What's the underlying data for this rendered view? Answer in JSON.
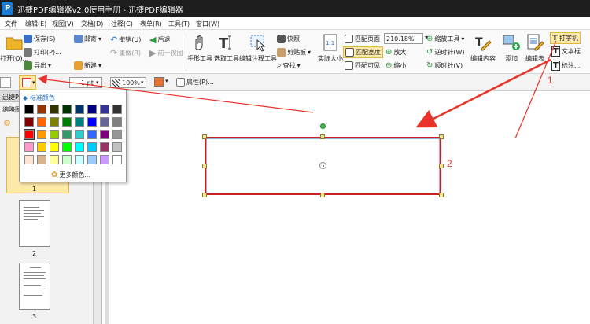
{
  "window": {
    "title": "迅捷PDF编辑器v2.0使用手册 - 迅捷PDF编辑器"
  },
  "menu": [
    "文件",
    "编辑(E)",
    "视图(V)",
    "文档(D)",
    "注释(C)",
    "表单(R)",
    "工具(T)",
    "窗口(W)"
  ],
  "ribbon": {
    "open": "打开(O)...",
    "save": "保存(S)",
    "print": "打印(P)...",
    "export": "导出",
    "email": "邮寄",
    "new": "新建",
    "undo": "撤销(U)",
    "redo": "重做(R)",
    "back": "后退",
    "forward": "前一视图",
    "hand": "手形工具",
    "select": "选取工具",
    "edit_annot": "编辑注释工具",
    "snapshot": "快照",
    "clipboard": "剪贴板",
    "find": "查找",
    "actual_size": "实际大小",
    "fit_page": "匹配页面",
    "fit_width": "匹配宽度",
    "fit_visible": "匹配可见",
    "zoom_value": "210.18%",
    "zoom_tool": "缩放工具",
    "zoom_in": "放大",
    "zoom_out": "缩小",
    "rotate_ccw": "逆时针(W)",
    "rotate_cw": "顺时针(V)",
    "edit_content": "编辑内容",
    "add": "添加",
    "edit_form": "编辑表",
    "typewriter": "打字机",
    "textbox": "文本框",
    "callout": "标注..."
  },
  "toolbar2": {
    "line_width": "1 pt",
    "opacity": "100%",
    "properties": "属性(P)..."
  },
  "sidebar": {
    "tab": "迅捷PD",
    "thumb_label": "缩略图",
    "pages": [
      "1",
      "2",
      "3"
    ]
  },
  "palette": {
    "header": "标准颜色",
    "more": "更多颜色...",
    "colors": [
      "#000000",
      "#993300",
      "#333300",
      "#003300",
      "#003366",
      "#000080",
      "#333399",
      "#333333",
      "#800000",
      "#ff6600",
      "#808000",
      "#008000",
      "#008080",
      "#0000ff",
      "#666699",
      "#808080",
      "#ff0000",
      "#ff9900",
      "#99cc00",
      "#339966",
      "#33cccc",
      "#3366ff",
      "#800080",
      "#969696",
      "#ff99cc",
      "#ffcc00",
      "#ffff00",
      "#00ff00",
      "#00ffff",
      "#00ccff",
      "#993366",
      "#c0c0c0",
      "#ffe4d6",
      "#d9b38c",
      "#ffff99",
      "#ccffcc",
      "#ccffff",
      "#99ccff",
      "#cc99ff",
      "#ffffff"
    ]
  },
  "annotations": {
    "label1": "1",
    "label2": "2"
  },
  "colors": {
    "accent_red": "#e8322a",
    "selection": "#cc1f1f"
  }
}
